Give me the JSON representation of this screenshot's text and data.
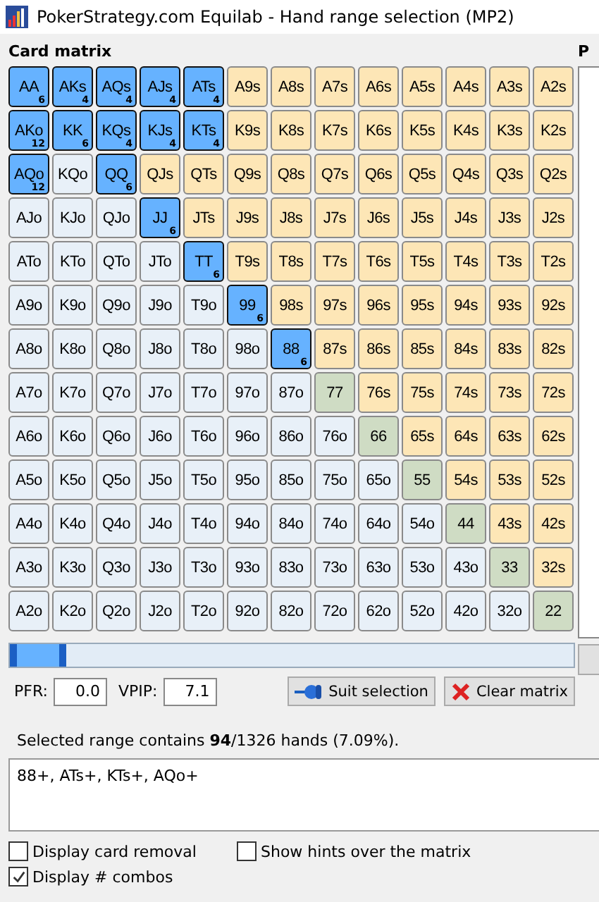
{
  "window": {
    "title": "PokerStrategy.com Equilab - Hand range selection (MP2)"
  },
  "matrix": {
    "title": "Card matrix",
    "rows": [
      [
        {
          "label": "AA",
          "selected": true,
          "combos": "6"
        },
        {
          "label": "AKs",
          "selected": true,
          "combos": "4"
        },
        {
          "label": "AQs",
          "selected": true,
          "combos": "4"
        },
        {
          "label": "AJs",
          "selected": true,
          "combos": "4"
        },
        {
          "label": "ATs",
          "selected": true,
          "combos": "4"
        },
        {
          "label": "A9s",
          "kind": "suited",
          "selected": false
        },
        {
          "label": "A8s",
          "kind": "suited",
          "selected": false
        },
        {
          "label": "A7s",
          "kind": "suited",
          "selected": false
        },
        {
          "label": "A6s",
          "kind": "suited",
          "selected": false
        },
        {
          "label": "A5s",
          "kind": "suited",
          "selected": false
        },
        {
          "label": "A4s",
          "kind": "suited",
          "selected": false
        },
        {
          "label": "A3s",
          "kind": "suited",
          "selected": false
        },
        {
          "label": "A2s",
          "kind": "suited",
          "selected": false
        }
      ],
      [
        {
          "label": "AKo",
          "selected": true,
          "combos": "12"
        },
        {
          "label": "KK",
          "selected": true,
          "combos": "6"
        },
        {
          "label": "KQs",
          "selected": true,
          "combos": "4"
        },
        {
          "label": "KJs",
          "selected": true,
          "combos": "4"
        },
        {
          "label": "KTs",
          "selected": true,
          "combos": "4"
        },
        {
          "label": "K9s",
          "kind": "suited",
          "selected": false
        },
        {
          "label": "K8s",
          "kind": "suited",
          "selected": false
        },
        {
          "label": "K7s",
          "kind": "suited",
          "selected": false
        },
        {
          "label": "K6s",
          "kind": "suited",
          "selected": false
        },
        {
          "label": "K5s",
          "kind": "suited",
          "selected": false
        },
        {
          "label": "K4s",
          "kind": "suited",
          "selected": false
        },
        {
          "label": "K3s",
          "kind": "suited",
          "selected": false
        },
        {
          "label": "K2s",
          "kind": "suited",
          "selected": false
        }
      ],
      [
        {
          "label": "AQo",
          "selected": true,
          "combos": "12"
        },
        {
          "label": "KQo",
          "kind": "offsuit",
          "selected": false
        },
        {
          "label": "QQ",
          "selected": true,
          "combos": "6"
        },
        {
          "label": "QJs",
          "kind": "suited",
          "selected": false
        },
        {
          "label": "QTs",
          "kind": "suited",
          "selected": false
        },
        {
          "label": "Q9s",
          "kind": "suited",
          "selected": false
        },
        {
          "label": "Q8s",
          "kind": "suited",
          "selected": false
        },
        {
          "label": "Q7s",
          "kind": "suited",
          "selected": false
        },
        {
          "label": "Q6s",
          "kind": "suited",
          "selected": false
        },
        {
          "label": "Q5s",
          "kind": "suited",
          "selected": false
        },
        {
          "label": "Q4s",
          "kind": "suited",
          "selected": false
        },
        {
          "label": "Q3s",
          "kind": "suited",
          "selected": false
        },
        {
          "label": "Q2s",
          "kind": "suited",
          "selected": false
        }
      ],
      [
        {
          "label": "AJo",
          "kind": "offsuit",
          "selected": false
        },
        {
          "label": "KJo",
          "kind": "offsuit",
          "selected": false
        },
        {
          "label": "QJo",
          "kind": "offsuit",
          "selected": false
        },
        {
          "label": "JJ",
          "selected": true,
          "combos": "6"
        },
        {
          "label": "JTs",
          "kind": "suited",
          "selected": false
        },
        {
          "label": "J9s",
          "kind": "suited",
          "selected": false
        },
        {
          "label": "J8s",
          "kind": "suited",
          "selected": false
        },
        {
          "label": "J7s",
          "kind": "suited",
          "selected": false
        },
        {
          "label": "J6s",
          "kind": "suited",
          "selected": false
        },
        {
          "label": "J5s",
          "kind": "suited",
          "selected": false
        },
        {
          "label": "J4s",
          "kind": "suited",
          "selected": false
        },
        {
          "label": "J3s",
          "kind": "suited",
          "selected": false
        },
        {
          "label": "J2s",
          "kind": "suited",
          "selected": false
        }
      ],
      [
        {
          "label": "ATo",
          "kind": "offsuit",
          "selected": false
        },
        {
          "label": "KTo",
          "kind": "offsuit",
          "selected": false
        },
        {
          "label": "QTo",
          "kind": "offsuit",
          "selected": false
        },
        {
          "label": "JTo",
          "kind": "offsuit",
          "selected": false
        },
        {
          "label": "TT",
          "selected": true,
          "combos": "6"
        },
        {
          "label": "T9s",
          "kind": "suited",
          "selected": false
        },
        {
          "label": "T8s",
          "kind": "suited",
          "selected": false
        },
        {
          "label": "T7s",
          "kind": "suited",
          "selected": false
        },
        {
          "label": "T6s",
          "kind": "suited",
          "selected": false
        },
        {
          "label": "T5s",
          "kind": "suited",
          "selected": false
        },
        {
          "label": "T4s",
          "kind": "suited",
          "selected": false
        },
        {
          "label": "T3s",
          "kind": "suited",
          "selected": false
        },
        {
          "label": "T2s",
          "kind": "suited",
          "selected": false
        }
      ],
      [
        {
          "label": "A9o",
          "kind": "offsuit",
          "selected": false
        },
        {
          "label": "K9o",
          "kind": "offsuit",
          "selected": false
        },
        {
          "label": "Q9o",
          "kind": "offsuit",
          "selected": false
        },
        {
          "label": "J9o",
          "kind": "offsuit",
          "selected": false
        },
        {
          "label": "T9o",
          "kind": "offsuit",
          "selected": false
        },
        {
          "label": "99",
          "selected": true,
          "combos": "6"
        },
        {
          "label": "98s",
          "kind": "suited",
          "selected": false
        },
        {
          "label": "97s",
          "kind": "suited",
          "selected": false
        },
        {
          "label": "96s",
          "kind": "suited",
          "selected": false
        },
        {
          "label": "95s",
          "kind": "suited",
          "selected": false
        },
        {
          "label": "94s",
          "kind": "suited",
          "selected": false
        },
        {
          "label": "93s",
          "kind": "suited",
          "selected": false
        },
        {
          "label": "92s",
          "kind": "suited",
          "selected": false
        }
      ],
      [
        {
          "label": "A8o",
          "kind": "offsuit",
          "selected": false
        },
        {
          "label": "K8o",
          "kind": "offsuit",
          "selected": false
        },
        {
          "label": "Q8o",
          "kind": "offsuit",
          "selected": false
        },
        {
          "label": "J8o",
          "kind": "offsuit",
          "selected": false
        },
        {
          "label": "T8o",
          "kind": "offsuit",
          "selected": false
        },
        {
          "label": "98o",
          "kind": "offsuit",
          "selected": false
        },
        {
          "label": "88",
          "selected": true,
          "combos": "6"
        },
        {
          "label": "87s",
          "kind": "suited",
          "selected": false
        },
        {
          "label": "86s",
          "kind": "suited",
          "selected": false
        },
        {
          "label": "85s",
          "kind": "suited",
          "selected": false
        },
        {
          "label": "84s",
          "kind": "suited",
          "selected": false
        },
        {
          "label": "83s",
          "kind": "suited",
          "selected": false
        },
        {
          "label": "82s",
          "kind": "suited",
          "selected": false
        }
      ],
      [
        {
          "label": "A7o",
          "kind": "offsuit",
          "selected": false
        },
        {
          "label": "K7o",
          "kind": "offsuit",
          "selected": false
        },
        {
          "label": "Q7o",
          "kind": "offsuit",
          "selected": false
        },
        {
          "label": "J7o",
          "kind": "offsuit",
          "selected": false
        },
        {
          "label": "T7o",
          "kind": "offsuit",
          "selected": false
        },
        {
          "label": "97o",
          "kind": "offsuit",
          "selected": false
        },
        {
          "label": "87o",
          "kind": "offsuit",
          "selected": false
        },
        {
          "label": "77",
          "kind": "pair",
          "selected": false
        },
        {
          "label": "76s",
          "kind": "suited",
          "selected": false
        },
        {
          "label": "75s",
          "kind": "suited",
          "selected": false
        },
        {
          "label": "74s",
          "kind": "suited",
          "selected": false
        },
        {
          "label": "73s",
          "kind": "suited",
          "selected": false
        },
        {
          "label": "72s",
          "kind": "suited",
          "selected": false
        }
      ],
      [
        {
          "label": "A6o",
          "kind": "offsuit",
          "selected": false
        },
        {
          "label": "K6o",
          "kind": "offsuit",
          "selected": false
        },
        {
          "label": "Q6o",
          "kind": "offsuit",
          "selected": false
        },
        {
          "label": "J6o",
          "kind": "offsuit",
          "selected": false
        },
        {
          "label": "T6o",
          "kind": "offsuit",
          "selected": false
        },
        {
          "label": "96o",
          "kind": "offsuit",
          "selected": false
        },
        {
          "label": "86o",
          "kind": "offsuit",
          "selected": false
        },
        {
          "label": "76o",
          "kind": "offsuit",
          "selected": false
        },
        {
          "label": "66",
          "kind": "pair",
          "selected": false
        },
        {
          "label": "65s",
          "kind": "suited",
          "selected": false
        },
        {
          "label": "64s",
          "kind": "suited",
          "selected": false
        },
        {
          "label": "63s",
          "kind": "suited",
          "selected": false
        },
        {
          "label": "62s",
          "kind": "suited",
          "selected": false
        }
      ],
      [
        {
          "label": "A5o",
          "kind": "offsuit",
          "selected": false
        },
        {
          "label": "K5o",
          "kind": "offsuit",
          "selected": false
        },
        {
          "label": "Q5o",
          "kind": "offsuit",
          "selected": false
        },
        {
          "label": "J5o",
          "kind": "offsuit",
          "selected": false
        },
        {
          "label": "T5o",
          "kind": "offsuit",
          "selected": false
        },
        {
          "label": "95o",
          "kind": "offsuit",
          "selected": false
        },
        {
          "label": "85o",
          "kind": "offsuit",
          "selected": false
        },
        {
          "label": "75o",
          "kind": "offsuit",
          "selected": false
        },
        {
          "label": "65o",
          "kind": "offsuit",
          "selected": false
        },
        {
          "label": "55",
          "kind": "pair",
          "selected": false
        },
        {
          "label": "54s",
          "kind": "suited",
          "selected": false
        },
        {
          "label": "53s",
          "kind": "suited",
          "selected": false
        },
        {
          "label": "52s",
          "kind": "suited",
          "selected": false
        }
      ],
      [
        {
          "label": "A4o",
          "kind": "offsuit",
          "selected": false
        },
        {
          "label": "K4o",
          "kind": "offsuit",
          "selected": false
        },
        {
          "label": "Q4o",
          "kind": "offsuit",
          "selected": false
        },
        {
          "label": "J4o",
          "kind": "offsuit",
          "selected": false
        },
        {
          "label": "T4o",
          "kind": "offsuit",
          "selected": false
        },
        {
          "label": "94o",
          "kind": "offsuit",
          "selected": false
        },
        {
          "label": "84o",
          "kind": "offsuit",
          "selected": false
        },
        {
          "label": "74o",
          "kind": "offsuit",
          "selected": false
        },
        {
          "label": "64o",
          "kind": "offsuit",
          "selected": false
        },
        {
          "label": "54o",
          "kind": "offsuit",
          "selected": false
        },
        {
          "label": "44",
          "kind": "pair",
          "selected": false
        },
        {
          "label": "43s",
          "kind": "suited",
          "selected": false
        },
        {
          "label": "42s",
          "kind": "suited",
          "selected": false
        }
      ],
      [
        {
          "label": "A3o",
          "kind": "offsuit",
          "selected": false
        },
        {
          "label": "K3o",
          "kind": "offsuit",
          "selected": false
        },
        {
          "label": "Q3o",
          "kind": "offsuit",
          "selected": false
        },
        {
          "label": "J3o",
          "kind": "offsuit",
          "selected": false
        },
        {
          "label": "T3o",
          "kind": "offsuit",
          "selected": false
        },
        {
          "label": "93o",
          "kind": "offsuit",
          "selected": false
        },
        {
          "label": "83o",
          "kind": "offsuit",
          "selected": false
        },
        {
          "label": "73o",
          "kind": "offsuit",
          "selected": false
        },
        {
          "label": "63o",
          "kind": "offsuit",
          "selected": false
        },
        {
          "label": "53o",
          "kind": "offsuit",
          "selected": false
        },
        {
          "label": "43o",
          "kind": "offsuit",
          "selected": false
        },
        {
          "label": "33",
          "kind": "pair",
          "selected": false
        },
        {
          "label": "32s",
          "kind": "suited",
          "selected": false
        }
      ],
      [
        {
          "label": "A2o",
          "kind": "offsuit",
          "selected": false
        },
        {
          "label": "K2o",
          "kind": "offsuit",
          "selected": false
        },
        {
          "label": "Q2o",
          "kind": "offsuit",
          "selected": false
        },
        {
          "label": "J2o",
          "kind": "offsuit",
          "selected": false
        },
        {
          "label": "T2o",
          "kind": "offsuit",
          "selected": false
        },
        {
          "label": "92o",
          "kind": "offsuit",
          "selected": false
        },
        {
          "label": "82o",
          "kind": "offsuit",
          "selected": false
        },
        {
          "label": "72o",
          "kind": "offsuit",
          "selected": false
        },
        {
          "label": "62o",
          "kind": "offsuit",
          "selected": false
        },
        {
          "label": "52o",
          "kind": "offsuit",
          "selected": false
        },
        {
          "label": "42o",
          "kind": "offsuit",
          "selected": false
        },
        {
          "label": "32o",
          "kind": "offsuit",
          "selected": false
        },
        {
          "label": "22",
          "kind": "pair",
          "selected": false
        }
      ]
    ]
  },
  "range_slider": {
    "level": 0.1
  },
  "stats": [
    {
      "label": "PFR:",
      "value": "0.0"
    },
    {
      "label": "VPIP:",
      "value": "7.1"
    }
  ],
  "buttons": [
    {
      "label": "Suit selection",
      "kind": "suit"
    },
    {
      "label": "Clear matrix",
      "kind": "clear"
    }
  ],
  "summary": "Selected range contains **94**/1326 hands (7.09%).",
  "range_text": "88+, ATs+, KTs+, AQo+",
  "options": [
    {
      "label": "Display card removal",
      "checked": false
    },
    {
      "label": "Show hints over the matrix",
      "checked": false
    },
    {
      "label": "Display # combos",
      "checked": true
    }
  ],
  "side_panel": {
    "title": "P"
  }
}
